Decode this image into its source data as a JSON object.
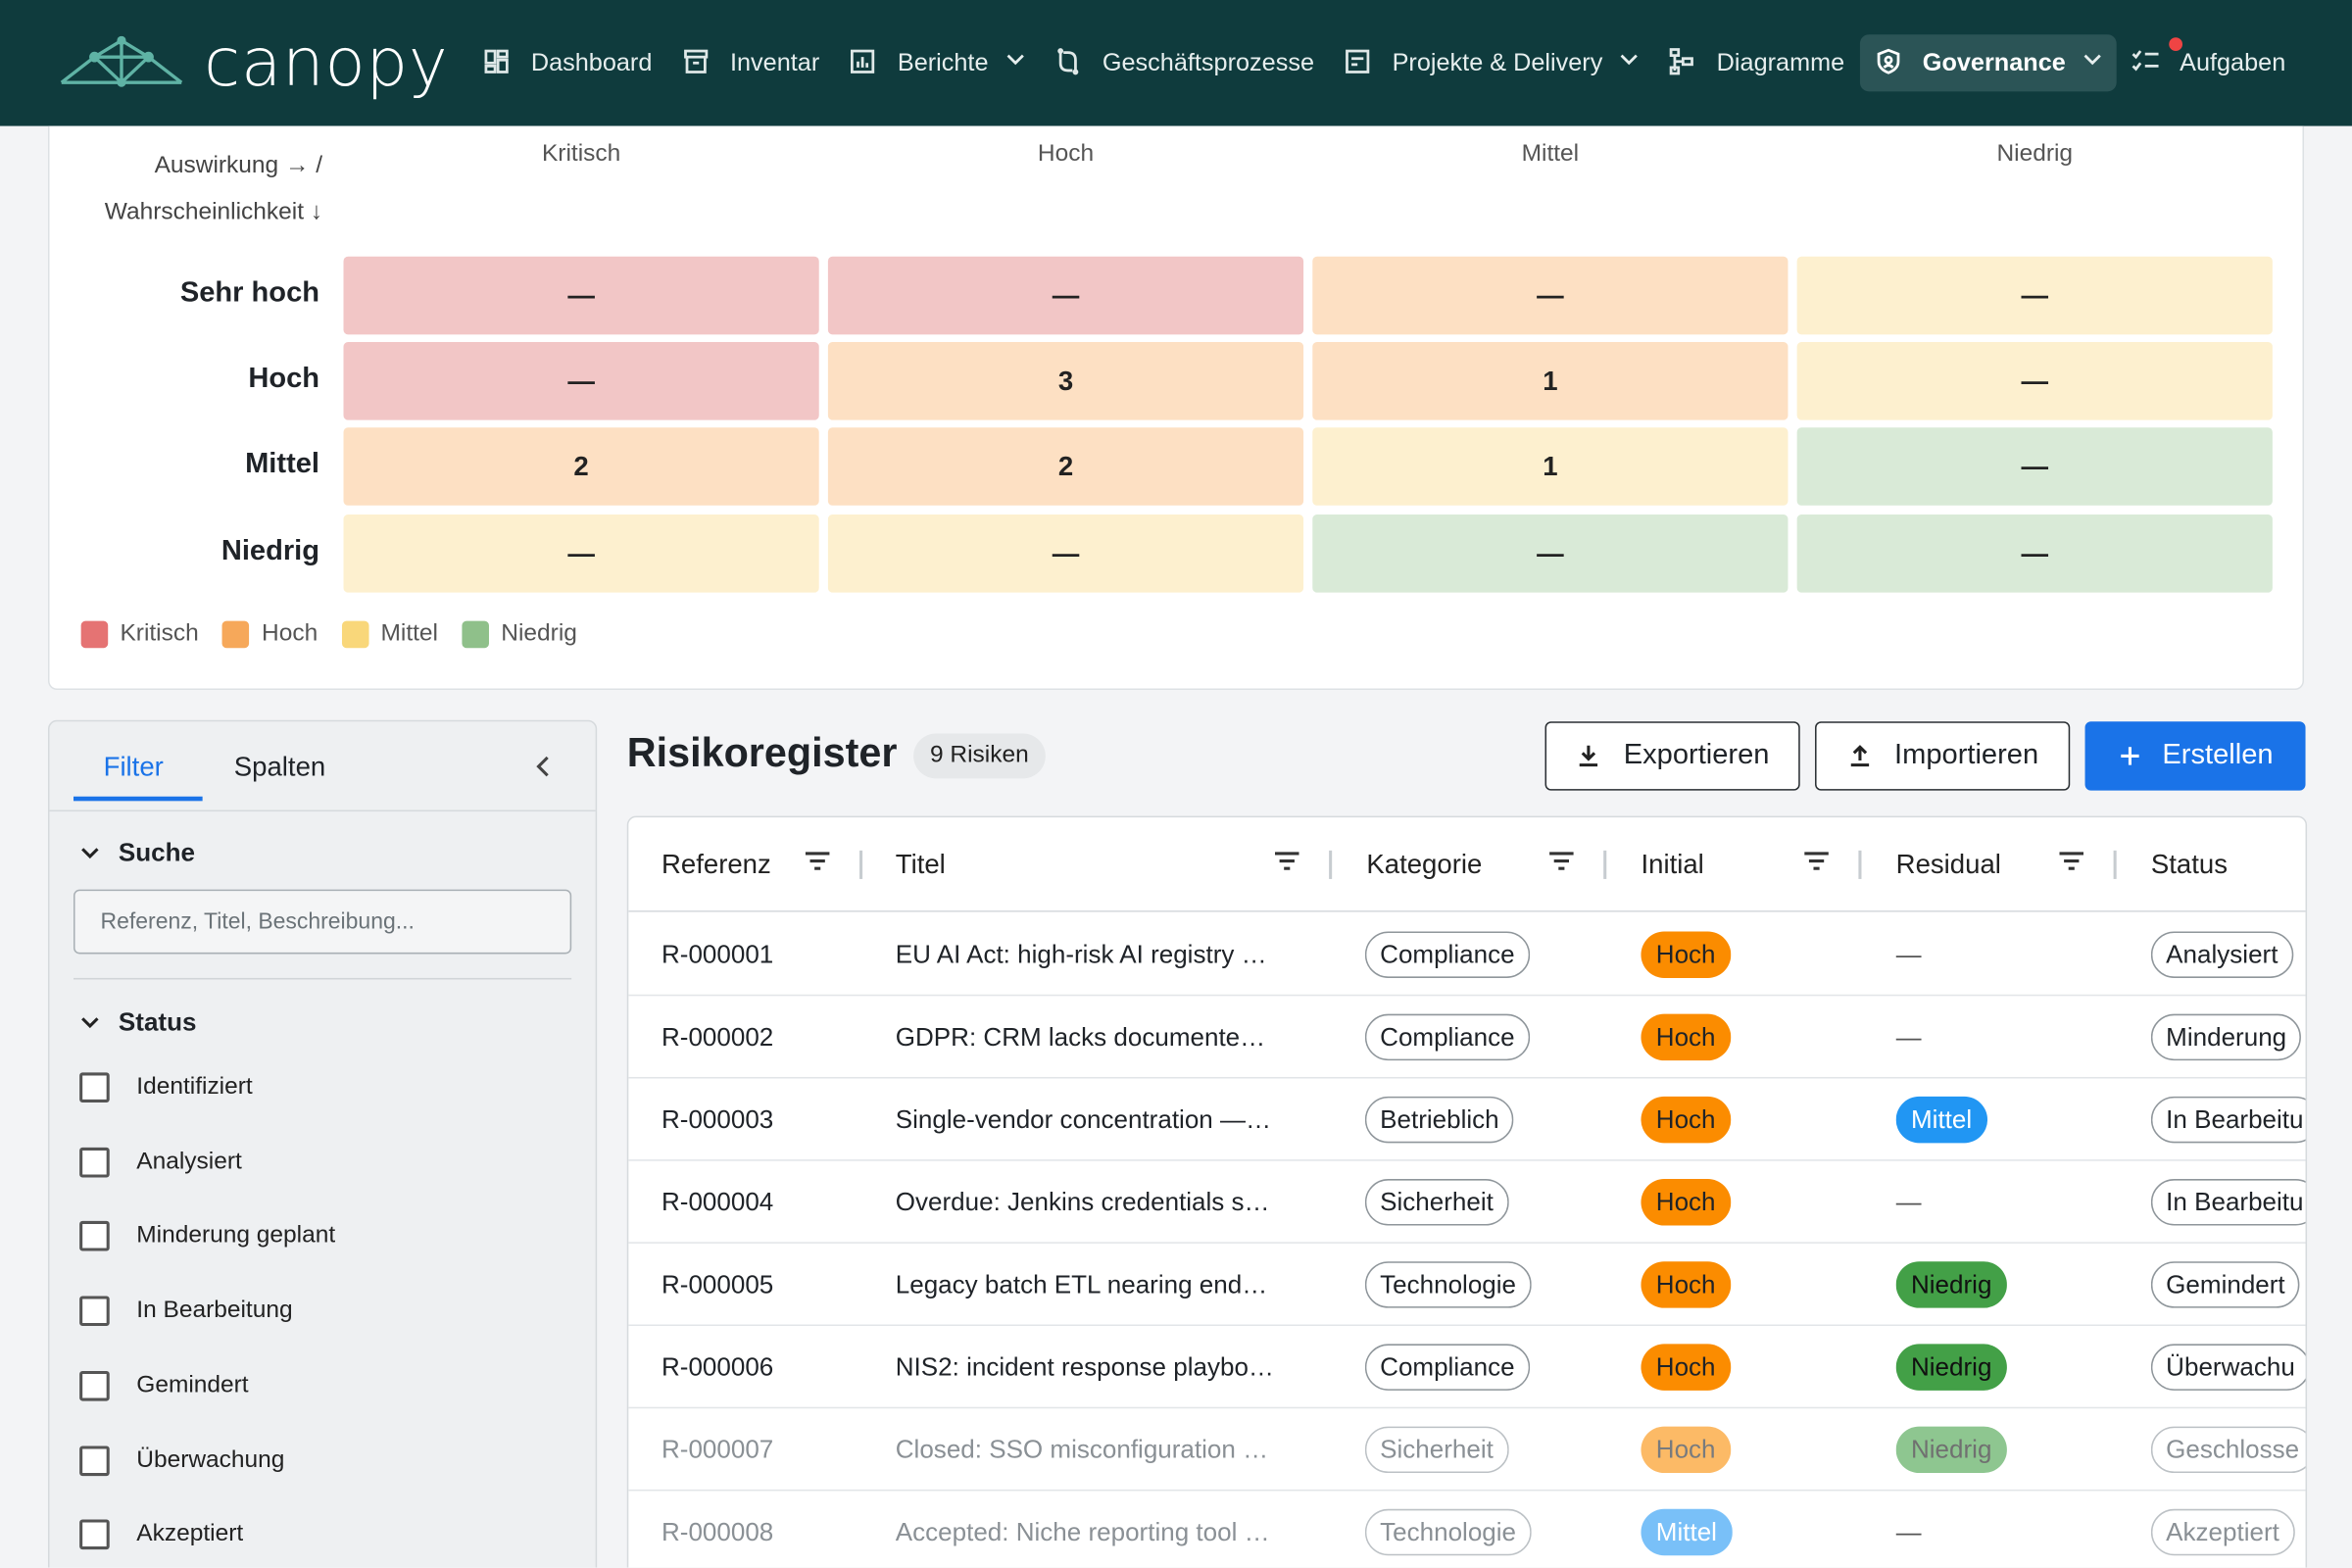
{
  "app": {
    "name": "canopy"
  },
  "nav": {
    "items": [
      {
        "label": "Dashboard",
        "icon": "dashboard-icon"
      },
      {
        "label": "Inventar",
        "icon": "archive-icon"
      },
      {
        "label": "Berichte",
        "icon": "chart-icon",
        "dropdown": true
      },
      {
        "label": "Geschäftsprozesse",
        "icon": "process-icon"
      },
      {
        "label": "Projekte & Delivery",
        "icon": "project-icon",
        "dropdown": true
      },
      {
        "label": "Diagramme",
        "icon": "diagram-icon"
      },
      {
        "label": "Governance",
        "icon": "shield-icon",
        "dropdown": true,
        "active": true
      },
      {
        "label": "Aufgaben",
        "icon": "tasks-icon",
        "notification": true
      }
    ]
  },
  "matrix": {
    "axis_impact": "Auswirkung → /",
    "axis_likelihood": "Wahrscheinlichkeit ↓",
    "columns": [
      "Kritisch",
      "Hoch",
      "Mittel",
      "Niedrig"
    ],
    "rows": [
      {
        "label": "Sehr hoch",
        "cells": [
          "—",
          "—",
          "—",
          "—"
        ],
        "levels": [
          "crit",
          "crit",
          "high",
          "med"
        ]
      },
      {
        "label": "Hoch",
        "cells": [
          "—",
          "3",
          "1",
          "—"
        ],
        "levels": [
          "crit",
          "high",
          "high",
          "med"
        ]
      },
      {
        "label": "Mittel",
        "cells": [
          "2",
          "2",
          "1",
          "—"
        ],
        "levels": [
          "high",
          "high",
          "med",
          "low"
        ]
      },
      {
        "label": "Niedrig",
        "cells": [
          "—",
          "—",
          "—",
          "—"
        ],
        "levels": [
          "med",
          "med",
          "low",
          "low"
        ]
      }
    ],
    "legend": [
      {
        "label": "Kritisch",
        "color": "#e57373"
      },
      {
        "label": "Hoch",
        "color": "#f6a85a"
      },
      {
        "label": "Mittel",
        "color": "#f9d77a"
      },
      {
        "label": "Niedrig",
        "color": "#8fc08a"
      }
    ]
  },
  "filter_panel": {
    "tabs": [
      "Filter",
      "Spalten"
    ],
    "search_section": "Suche",
    "search_placeholder": "Referenz, Titel, Beschreibung...",
    "status_section": "Status",
    "status_options": [
      "Identifiziert",
      "Analysiert",
      "Minderung geplant",
      "In Bearbeitung",
      "Gemindert",
      "Überwachung",
      "Akzeptiert"
    ]
  },
  "register": {
    "title": "Risikoregister",
    "count": "9 Risiken",
    "export_label": "Exportieren",
    "import_label": "Importieren",
    "create_label": "Erstellen",
    "columns": [
      "Referenz",
      "Titel",
      "Kategorie",
      "Initial",
      "Residual",
      "Status"
    ],
    "rows": [
      {
        "ref": "R-000001",
        "title": "EU AI Act: high-risk AI registry …",
        "category": "Compliance",
        "initial": "Hoch",
        "residual": "—",
        "status": "Analysiert"
      },
      {
        "ref": "R-000002",
        "title": "GDPR: CRM lacks documente…",
        "category": "Compliance",
        "initial": "Hoch",
        "residual": "—",
        "status": "Minderung"
      },
      {
        "ref": "R-000003",
        "title": "Single-vendor concentration —…",
        "category": "Betrieblich",
        "initial": "Hoch",
        "residual": "Mittel",
        "status": "In Bearbeitu"
      },
      {
        "ref": "R-000004",
        "title": "Overdue: Jenkins credentials s…",
        "category": "Sicherheit",
        "initial": "Hoch",
        "residual": "—",
        "status": "In Bearbeitu"
      },
      {
        "ref": "R-000005",
        "title": "Legacy batch ETL nearing end…",
        "category": "Technologie",
        "initial": "Hoch",
        "residual": "Niedrig",
        "status": "Gemindert"
      },
      {
        "ref": "R-000006",
        "title": "NIS2: incident response playbo…",
        "category": "Compliance",
        "initial": "Hoch",
        "residual": "Niedrig",
        "status": "Überwachu"
      },
      {
        "ref": "R-000007",
        "title": "Closed: SSO misconfiguration …",
        "category": "Sicherheit",
        "initial": "Hoch",
        "residual": "Niedrig",
        "status": "Geschlosse",
        "muted": true
      },
      {
        "ref": "R-000008",
        "title": "Accepted: Niche reporting tool …",
        "category": "Technologie",
        "initial": "Mittel",
        "residual": "—",
        "status": "Akzeptiert",
        "muted": true
      }
    ]
  }
}
